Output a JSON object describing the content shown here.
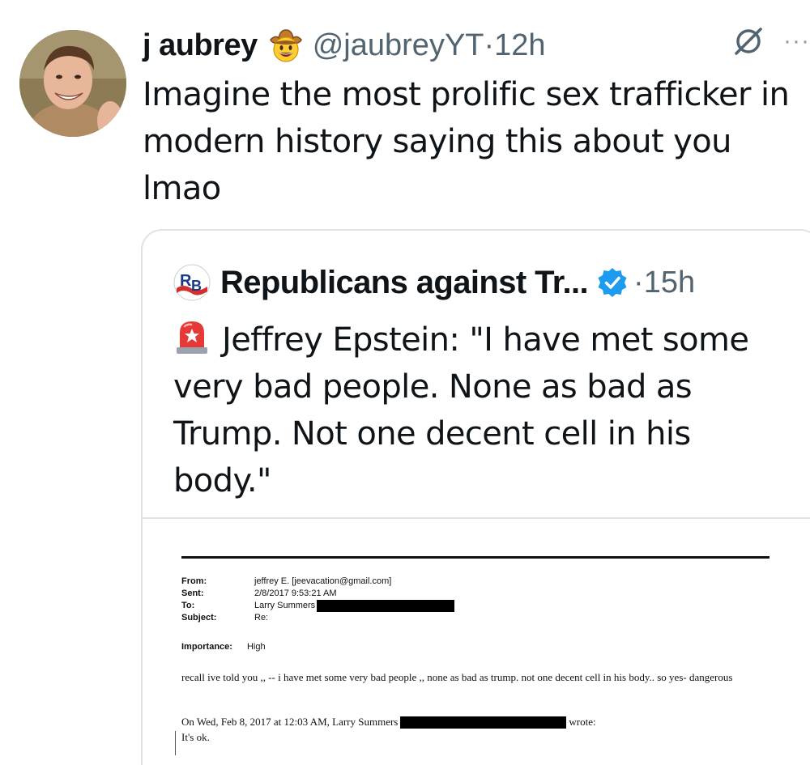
{
  "tweet": {
    "display_name": "j aubrey",
    "name_emoji": "cowboy-hat-face-emoji",
    "handle": "@jaubreyYT",
    "separator": "·",
    "time": "12h",
    "text": "Imagine the most prolific sex trafficker in\nmodern history saying this about you\nlmao",
    "actions": {
      "grok_icon": "grok-icon",
      "more_icon": "more-icon"
    }
  },
  "quote": {
    "account_name": "Republicans against Tr...",
    "verified": true,
    "separator": "·",
    "time": "15h",
    "siren_icon": "police-siren-emoji",
    "text": "Jeffrey Epstein: \"I have met some very bad people. None as bad as Trump. Not one decent cell in his body.\""
  },
  "document": {
    "fields": [
      {
        "label": "From:",
        "value": "jeffrey E. [jeevacation@gmail.com]"
      },
      {
        "label": "Sent:",
        "value": "2/8/2017 9:53:21 AM"
      },
      {
        "label": "To:",
        "value": "Larry Summers"
      },
      {
        "label": "Subject:",
        "value": "Re:"
      }
    ],
    "importance_label": "Importance:",
    "importance_value": "High",
    "body": "recall ive told you ,, -- i have met some very bad people ,, none as bad as trump. not one decent cell in his body.. so yes- dangerous",
    "reply_prefix": "On Wed, Feb 8, 2017 at 12:03 AM, Larry Summers",
    "reply_suffix": "wrote:",
    "reply_body": "It's ok."
  },
  "colors": {
    "text": "#0f1419",
    "secondary": "#536471",
    "verified_blue": "#1d9bf0",
    "border": "#dfe3e6"
  }
}
